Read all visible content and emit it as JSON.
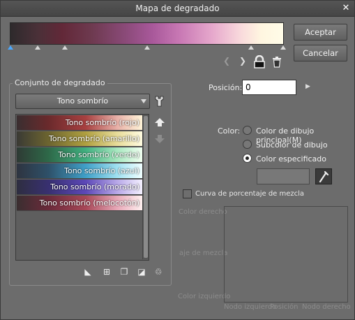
{
  "title": "Mapa de degradado",
  "buttons": {
    "ok": "Aceptar",
    "cancel": "Cancelar"
  },
  "gradient_set": {
    "group_label": "Conjunto de degradado",
    "selected": "Tono sombrío",
    "items": [
      {
        "label": "Tono sombrío (rojo)"
      },
      {
        "label": "Tono sombrío (amarillo)"
      },
      {
        "label": "Tono sombrío (verde)"
      },
      {
        "label": "Tono sombrío (azul)"
      },
      {
        "label": "Tono sombrío (morado)"
      },
      {
        "label": "Tono sombrío (melocotón)"
      }
    ]
  },
  "position": {
    "label": "Posición:",
    "value": "0"
  },
  "color": {
    "label": "Color:",
    "options": [
      "Color de dibujo principal(M)",
      "Subcolor de dibujo",
      "Color especificado"
    ],
    "selected_index": 2
  },
  "curve": {
    "checkbox_label": "Curva de porcentaje de mezcla",
    "color_right": "Color derecho",
    "blend_ratio": "aje de mezcla",
    "color_left": "Color izquierdo",
    "left_node": "Nodo izquierdo",
    "position": "Posición",
    "right_node": "Nodo derecho"
  },
  "icons": {
    "close": "close-icon",
    "wrench": "wrench-icon",
    "up": "arrow-up-icon",
    "down": "arrow-down-icon",
    "lock": "lock-icon",
    "trash": "trash-icon",
    "eyedropper": "eyedropper-icon"
  }
}
